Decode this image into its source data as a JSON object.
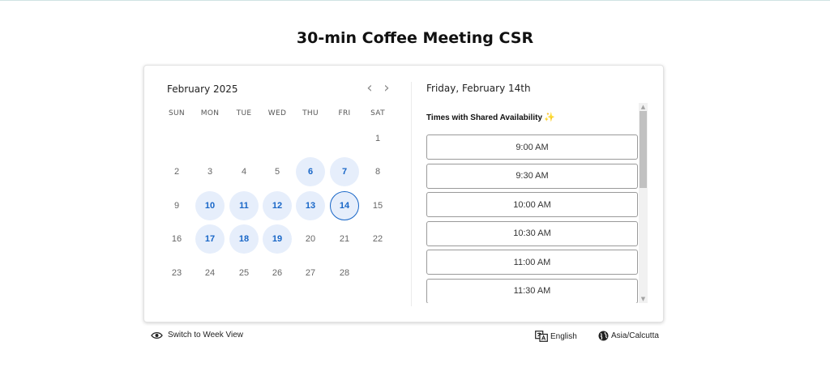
{
  "page": {
    "title": "30-min Coffee Meeting CSR"
  },
  "calendar": {
    "month_label": "February 2025",
    "weekdays": [
      "SUN",
      "MON",
      "TUE",
      "WED",
      "THU",
      "FRI",
      "SAT"
    ],
    "weeks": [
      [
        null,
        null,
        null,
        null,
        null,
        null,
        "1"
      ],
      [
        "2",
        "3",
        "4",
        "5",
        "6",
        "7",
        "8"
      ],
      [
        "9",
        "10",
        "11",
        "12",
        "13",
        "14",
        "15"
      ],
      [
        "16",
        "17",
        "18",
        "19",
        "20",
        "21",
        "22"
      ],
      [
        "23",
        "24",
        "25",
        "26",
        "27",
        "28",
        null
      ]
    ],
    "available_days": [
      "6",
      "7",
      "10",
      "11",
      "12",
      "13",
      "14",
      "17",
      "18",
      "19"
    ],
    "selected_day": "14",
    "accent_color": "#1866c7",
    "available_bg": "#e6eefb",
    "prev_icon": "chevron-left-icon",
    "next_icon": "chevron-right-icon"
  },
  "times": {
    "date_heading": "Friday, February 14th",
    "section_label": "Times with Shared Availability",
    "section_icon": "sparkles-icon",
    "slots": [
      "9:00 AM",
      "9:30 AM",
      "10:00 AM",
      "10:30 AM",
      "11:00 AM",
      "11:30 AM"
    ]
  },
  "footer": {
    "week_view_label": "Switch to Week View",
    "week_view_icon": "eye-icon",
    "language_label": "English",
    "language_icon": "translate-icon",
    "timezone_label": "Asia/Calcutta",
    "timezone_icon": "globe-icon"
  }
}
